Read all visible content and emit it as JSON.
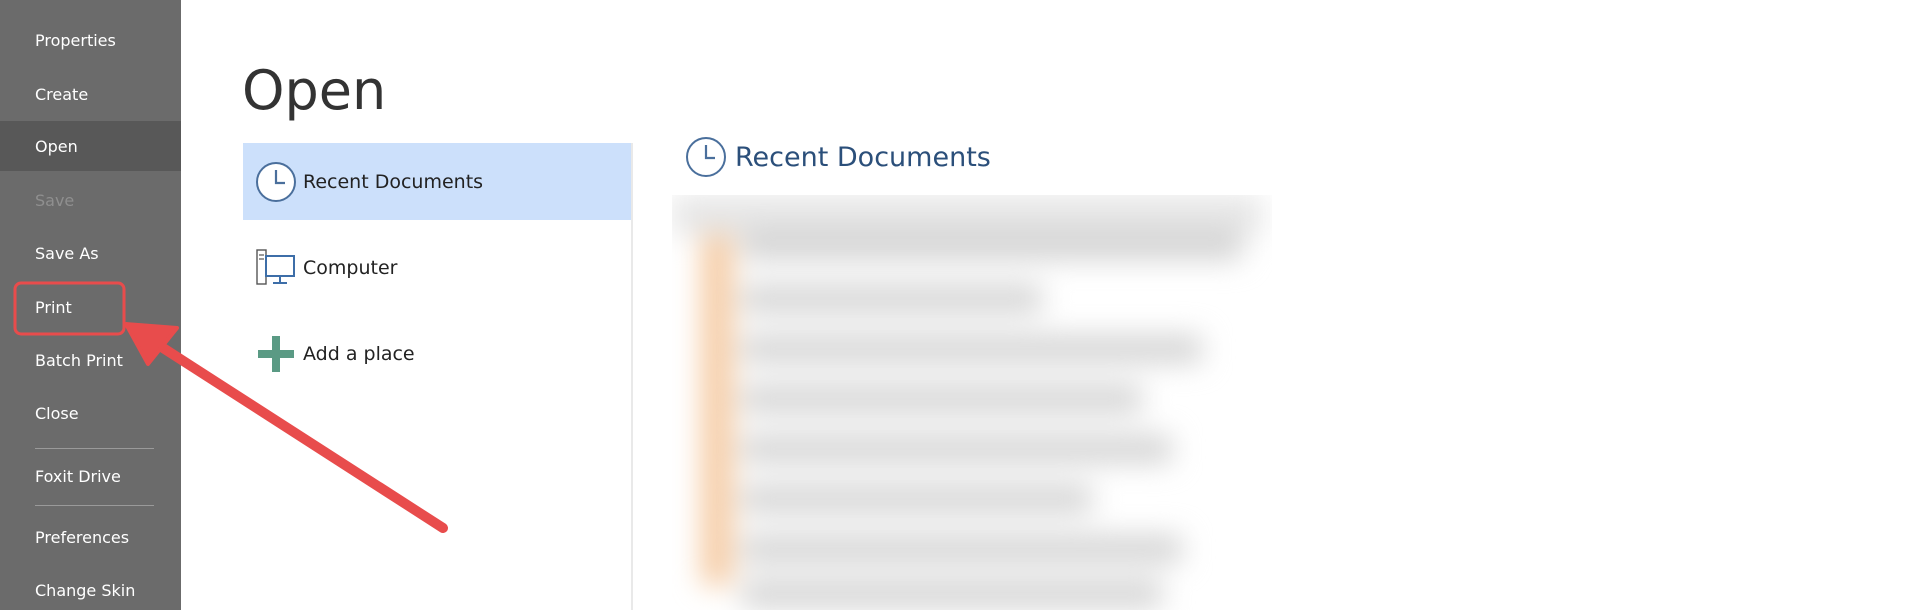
{
  "sidebar": {
    "items": [
      {
        "label": "Properties",
        "state": "normal"
      },
      {
        "label": "Create",
        "state": "normal"
      },
      {
        "label": "Open",
        "state": "active"
      },
      {
        "label": "Save",
        "state": "disabled"
      },
      {
        "label": "Save As",
        "state": "normal"
      },
      {
        "label": "Print",
        "state": "highlighted"
      },
      {
        "label": "Batch Print",
        "state": "normal"
      },
      {
        "label": "Close",
        "state": "normal"
      },
      {
        "label": "Foxit Drive",
        "state": "normal"
      },
      {
        "label": "Preferences",
        "state": "normal"
      },
      {
        "label": "Change Skin",
        "state": "normal"
      }
    ]
  },
  "main": {
    "title": "Open",
    "places": [
      {
        "label": "Recent Documents",
        "icon": "clock-icon",
        "selected": true
      },
      {
        "label": "Computer",
        "icon": "computer-icon",
        "selected": false
      },
      {
        "label": "Add a place",
        "icon": "plus-icon",
        "selected": false
      }
    ],
    "recent": {
      "title": "Recent Documents",
      "icon": "clock-icon"
    }
  },
  "annotation": {
    "highlight_color": "#e84c4c",
    "arrow_color": "#e84c4c"
  },
  "colors": {
    "sidebar_bg": "#6b6b6b",
    "sidebar_active_bg": "#585858",
    "selected_place_bg": "#cce0fb",
    "header_text": "#2b4f7a"
  }
}
